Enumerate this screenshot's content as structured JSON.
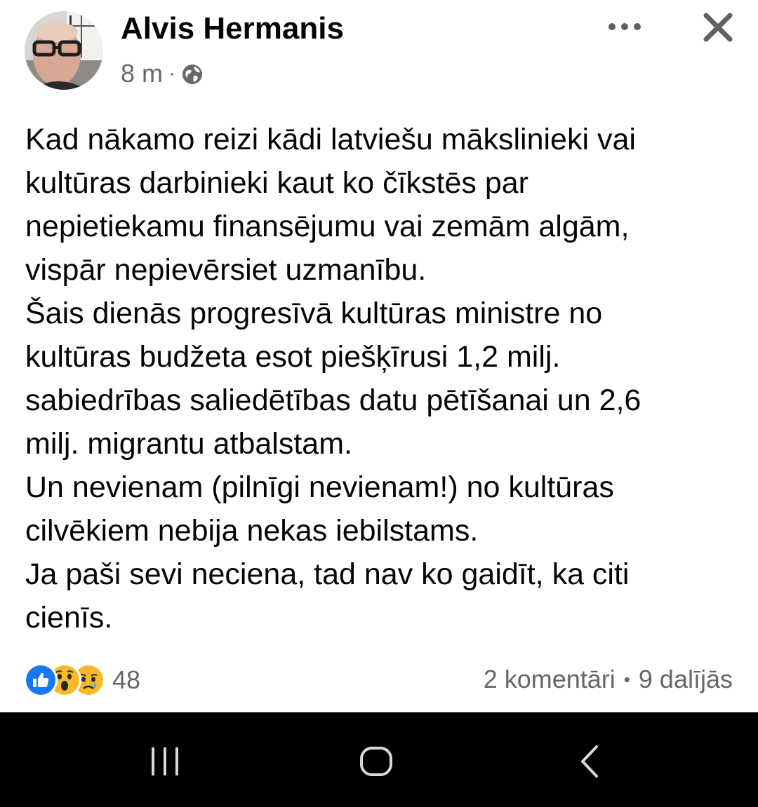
{
  "post": {
    "author": "Alvis Hermanis",
    "timestamp": "8 m",
    "meta_separator": "·",
    "privacy_icon": "globe-icon",
    "text_lines": [
      "Kad nākamo reizi kādi latviešu mākslinieki vai",
      "kultūras darbinieki kaut ko čīkstēs par",
      "nepietiekamu finansējumu vai zemām algām,",
      "vispār nepievērsiet uzmanību.",
      "Šais dienās progresīvā kultūras ministre no",
      "kultūras budžeta esot piešķīrusi 1,2 milj.",
      "sabiedrības saliedētības datu pētīšanai un 2,6",
      "milj. migrantu atbalstam.",
      "Un nevienam (pilnīgi nevienam!) no kultūras",
      "cilvēkiem nebija nekas iebilstams.",
      "Ja paši sevi neciena, tad nav ko gaidīt, ka citi",
      "cienīs."
    ]
  },
  "header": {
    "more_icon": "more-horizontal-icon",
    "close_icon": "close-icon"
  },
  "footer": {
    "reaction_icons": [
      "like-icon",
      "wow-icon",
      "sad-icon"
    ],
    "reaction_count": "48",
    "comments": "2 komentāri",
    "separator": "•",
    "shares": "9 dalījās"
  },
  "navbar": {
    "icons": [
      "recent-apps-icon",
      "home-icon",
      "back-icon"
    ]
  },
  "colors": {
    "text": "#050505",
    "secondary_text": "#65676b",
    "like_blue": "#1877f2",
    "emoji_yellow": "#f7b928",
    "navbar_bg": "#000000"
  }
}
